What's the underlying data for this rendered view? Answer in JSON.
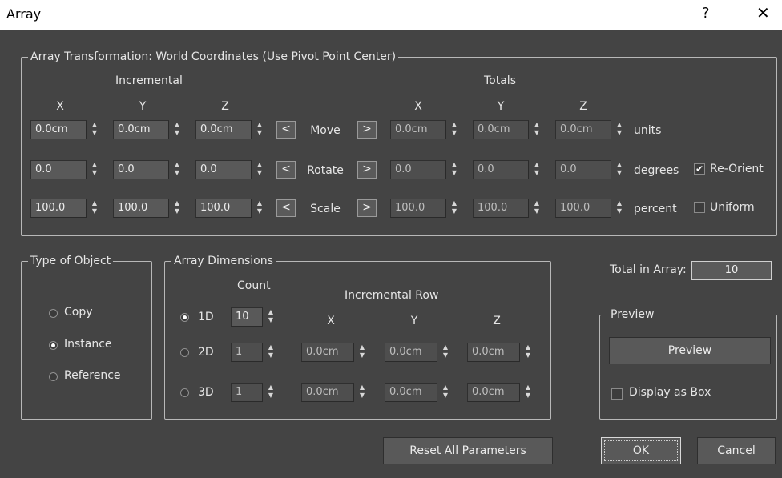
{
  "window": {
    "title": "Array",
    "help": "?",
    "close": "✕"
  },
  "transform": {
    "legend": "Array Transformation: World Coordinates (Use Pivot Point Center)",
    "incremental_label": "Incremental",
    "totals_label": "Totals",
    "axes": [
      "X",
      "Y",
      "Z"
    ],
    "rows": [
      {
        "label": "Move",
        "inc": [
          "0.0cm",
          "0.0cm",
          "0.0cm"
        ],
        "tot": [
          "0.0cm",
          "0.0cm",
          "0.0cm"
        ],
        "unit": "units"
      },
      {
        "label": "Rotate",
        "inc": [
          "0.0",
          "0.0",
          "0.0"
        ],
        "tot": [
          "0.0",
          "0.0",
          "0.0"
        ],
        "unit": "degrees"
      },
      {
        "label": "Scale",
        "inc": [
          "100.0",
          "100.0",
          "100.0"
        ],
        "tot": [
          "100.0",
          "100.0",
          "100.0"
        ],
        "unit": "percent"
      }
    ],
    "left_arrow": "<",
    "right_arrow": ">",
    "reorient_label": "Re-Orient",
    "reorient_checked": true,
    "uniform_label": "Uniform",
    "uniform_checked": false
  },
  "type_of_object": {
    "legend": "Type of Object",
    "options": [
      {
        "label": "Copy",
        "selected": false
      },
      {
        "label": "Instance",
        "selected": true
      },
      {
        "label": "Reference",
        "selected": false
      }
    ]
  },
  "dimensions": {
    "legend": "Array Dimensions",
    "count_label": "Count",
    "incremental_row_label": "Incremental Row",
    "axes": [
      "X",
      "Y",
      "Z"
    ],
    "rows": [
      {
        "label": "1D",
        "selected": true,
        "count": "10",
        "values": null
      },
      {
        "label": "2D",
        "selected": false,
        "count": "1",
        "values": [
          "0.0cm",
          "0.0cm",
          "0.0cm"
        ]
      },
      {
        "label": "3D",
        "selected": false,
        "count": "1",
        "values": [
          "0.0cm",
          "0.0cm",
          "0.0cm"
        ]
      }
    ]
  },
  "total": {
    "label": "Total in Array:",
    "value": "10"
  },
  "preview": {
    "legend": "Preview",
    "button": "Preview",
    "display_box_label": "Display as Box",
    "display_box_checked": false
  },
  "actions": {
    "reset": "Reset All Parameters",
    "ok": "OK",
    "cancel": "Cancel"
  }
}
